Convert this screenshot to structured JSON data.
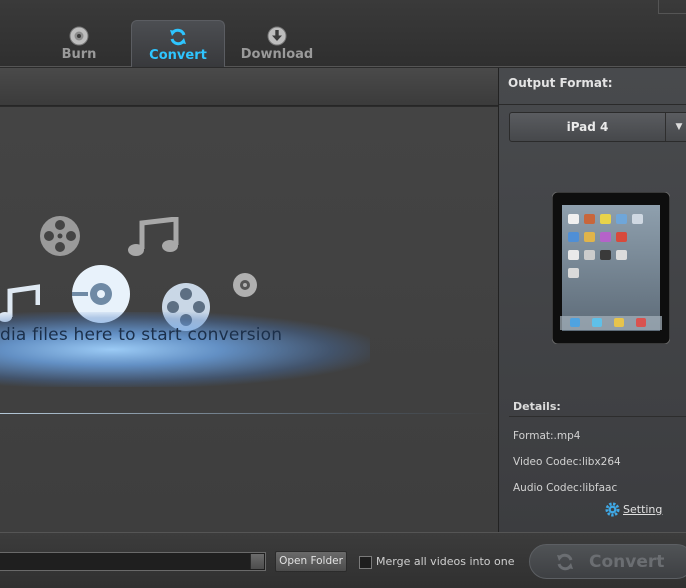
{
  "tabs": [
    {
      "label": "Burn"
    },
    {
      "label": "Convert"
    },
    {
      "label": "Download"
    }
  ],
  "drop_zone": {
    "message": "dia files here to start conversion"
  },
  "output": {
    "title": "Output Format:",
    "format": "iPad 4",
    "details_title": "Details:",
    "details": [
      "Format:.mp4",
      "Video Codec:libx264",
      "Audio Codec:libfaac"
    ],
    "setting_label": "Setting"
  },
  "bottom": {
    "open_folder_label": "Open Folder",
    "merge_label": "Merge all videos into one",
    "convert_label": "Convert"
  },
  "colors": {
    "accent": "#2ec5ff",
    "background": "#2b2b2b",
    "panel": "#44464a"
  }
}
